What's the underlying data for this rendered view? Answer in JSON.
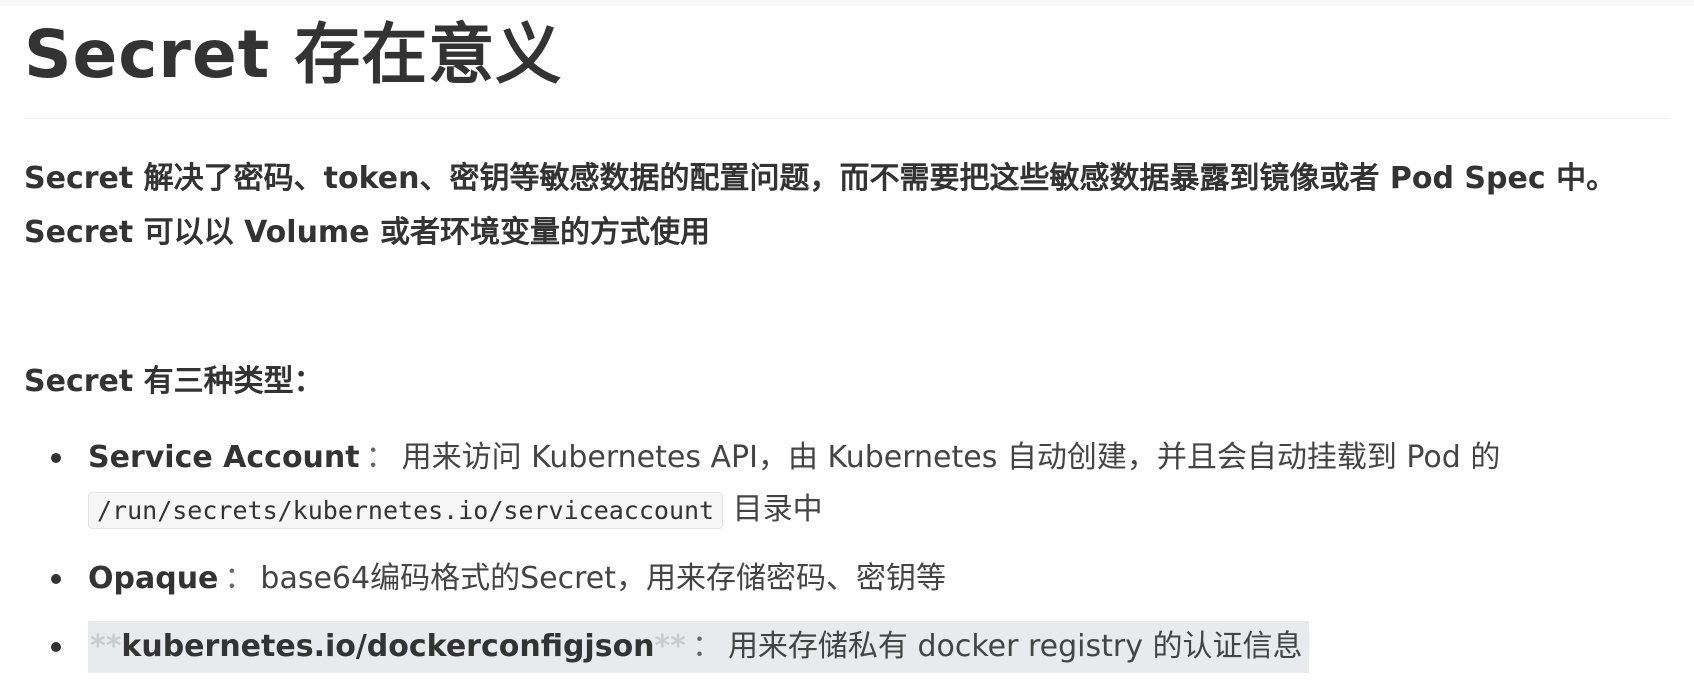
{
  "heading": "Secret 存在意义",
  "intro": "Secret 解决了密码、token、密钥等敏感数据的配置问题，而不需要把这些敏感数据暴露到镜像或者 Pod Spec 中。Secret 可以以 Volume 或者环境变量的方式使用",
  "types_title": "Secret 有三种类型：",
  "types": [
    {
      "term": "Service Account",
      "separator": "：",
      "description": "用来访问 Kubernetes API，由 Kubernetes 自动创建，并且会自动挂载到 Pod 的",
      "code": "/run/secrets/kubernetes.io/serviceaccount",
      "suffix": "目录中"
    },
    {
      "term": "Opaque",
      "separator": "：",
      "description": "base64编码格式的Secret，用来存储密码、密钥等"
    },
    {
      "prefix_marks": "**",
      "term": "kubernetes.io/dockerconfigjson",
      "suffix_marks": "**",
      "separator": "：",
      "description": "用来存储私有 docker registry 的认证信息"
    }
  ]
}
